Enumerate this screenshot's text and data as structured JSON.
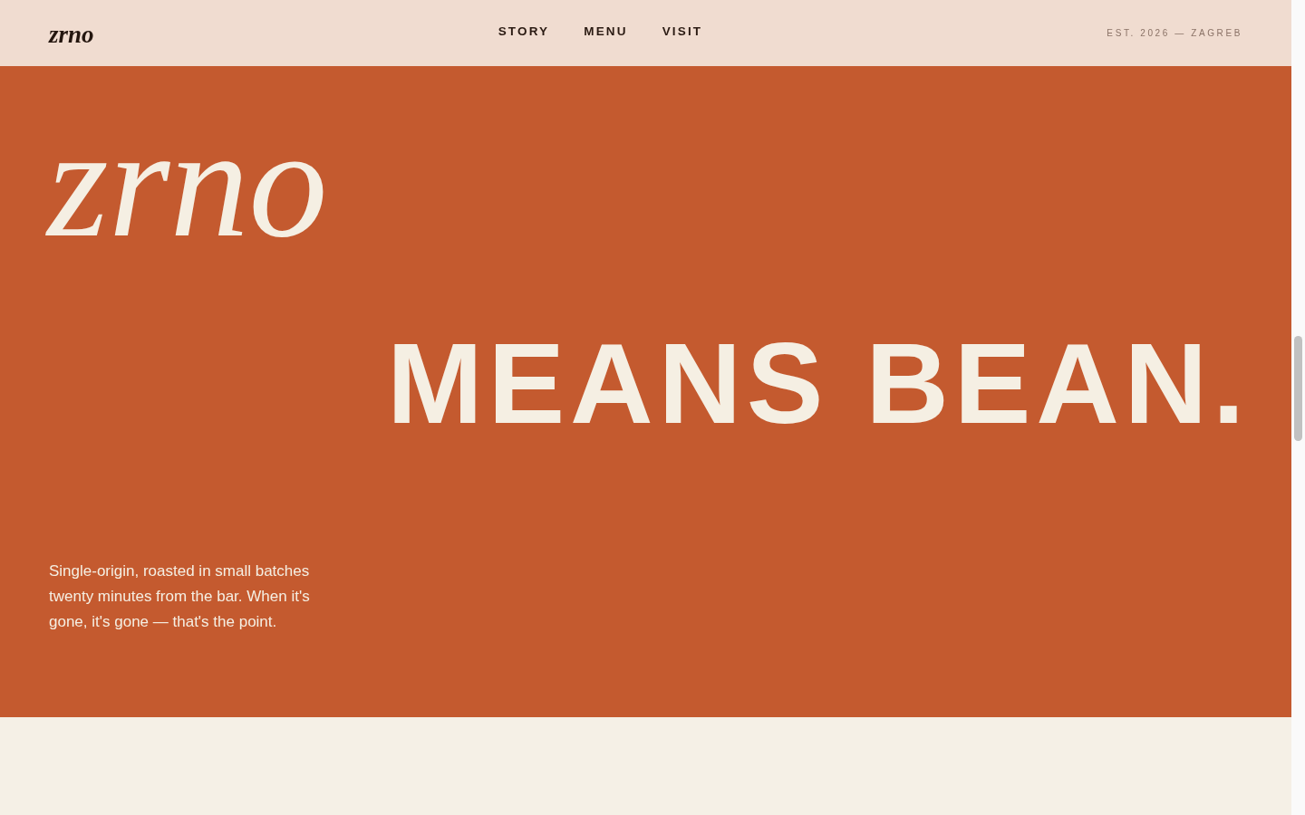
{
  "header": {
    "logo": "zrno",
    "nav": [
      "STORY",
      "MENU",
      "VISIT"
    ],
    "tagline": "EST. 2026 — ZAGREB"
  },
  "hero": {
    "wordmark": "zrno",
    "headline": "MEANS BEAN.",
    "description": "Single-origin, roasted in small batches twenty minutes from the bar. When it's gone, it's gone — that's the point."
  }
}
